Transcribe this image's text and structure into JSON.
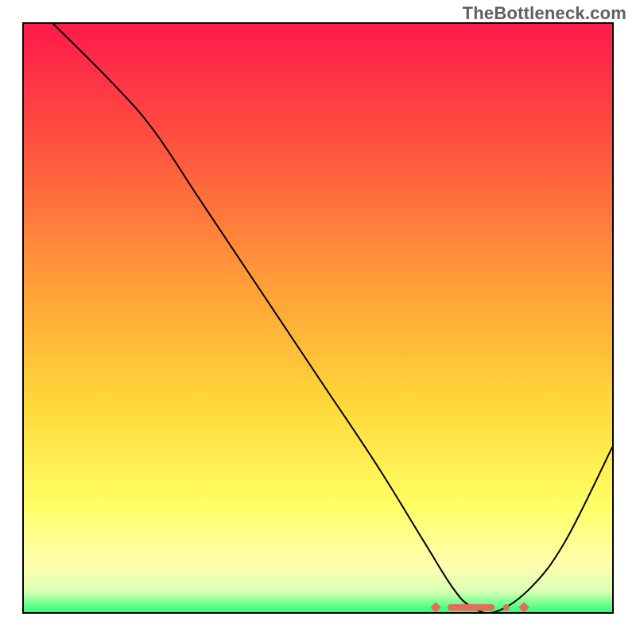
{
  "watermark": "TheBottleneck.com",
  "chart_data": {
    "type": "line",
    "title": "",
    "xlabel": "",
    "ylabel": "",
    "xlim": [
      0,
      100
    ],
    "ylim": [
      0,
      100
    ],
    "grid": false,
    "legend": false,
    "annotations": [],
    "background_gradient": {
      "orientation": "vertical",
      "stops": [
        {
          "pos": 0.0,
          "color": "#ff1a4b"
        },
        {
          "pos": 0.2,
          "color": "#ff5140"
        },
        {
          "pos": 0.45,
          "color": "#ffa038"
        },
        {
          "pos": 0.65,
          "color": "#ffd93a"
        },
        {
          "pos": 0.82,
          "color": "#ffff66"
        },
        {
          "pos": 0.92,
          "color": "#ffffb0"
        },
        {
          "pos": 0.965,
          "color": "#d9ffb3"
        },
        {
          "pos": 1.0,
          "color": "#2bff77"
        }
      ]
    },
    "series": [
      {
        "name": "bottleneck-curve",
        "color": "#000000",
        "x": [
          5,
          15,
          22,
          30,
          40,
          50,
          60,
          68,
          73,
          76,
          80,
          86,
          92,
          100
        ],
        "y": [
          100,
          90,
          82,
          70,
          55,
          40,
          25,
          12,
          4,
          1,
          0,
          4,
          12,
          28
        ]
      }
    ],
    "markers": [
      {
        "name": "baseline-cluster",
        "color": "#e86a5a",
        "shape": "pill+diamond",
        "points": [
          {
            "x": 70,
            "y": 0.8,
            "kind": "diamond"
          },
          {
            "x": 72,
            "y": 0.8,
            "kind": "bar-start"
          },
          {
            "x": 80,
            "y": 0.8,
            "kind": "bar-end"
          },
          {
            "x": 82,
            "y": 0.8,
            "kind": "dot"
          },
          {
            "x": 85,
            "y": 0.8,
            "kind": "diamond"
          }
        ]
      }
    ]
  }
}
